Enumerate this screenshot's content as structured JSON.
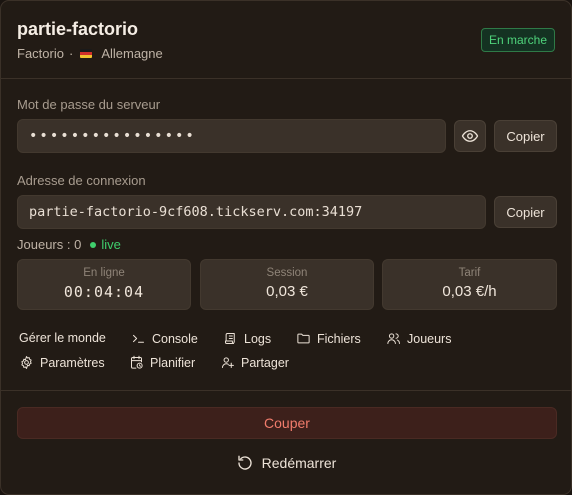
{
  "header": {
    "title": "partie-factorio",
    "game": "Factorio",
    "separator": "·",
    "flag_icon": "germany-flag-icon",
    "region": "Allemagne",
    "status": "En marche",
    "status_color": "#4fd37b"
  },
  "password": {
    "label": "Mot de passe du serveur",
    "value": "••••••••••••••••",
    "reveal_icon": "eye-icon",
    "copy_label": "Copier"
  },
  "connection": {
    "label": "Adresse de connexion",
    "value": "partie-factorio-9cf608.tickserv.com:34197",
    "copy_label": "Copier"
  },
  "players": {
    "label": "Joueurs : 0",
    "live": "live"
  },
  "stats": [
    {
      "label": "En ligne",
      "value": "00:04:04"
    },
    {
      "label": "Session",
      "value": "0,03 €"
    },
    {
      "label": "Tarif",
      "value": "0,03 €/h"
    }
  ],
  "actions": {
    "manage_world": "Gérer le monde",
    "console": "Console",
    "logs": "Logs",
    "files": "Fichiers",
    "players": "Joueurs",
    "settings": "Paramètres",
    "schedule": "Planifier",
    "share": "Partager"
  },
  "footer": {
    "shutdown": "Couper",
    "shutdown_color": "#f17c6c",
    "restart": "Redémarrer",
    "restart_icon": "restart-icon"
  }
}
